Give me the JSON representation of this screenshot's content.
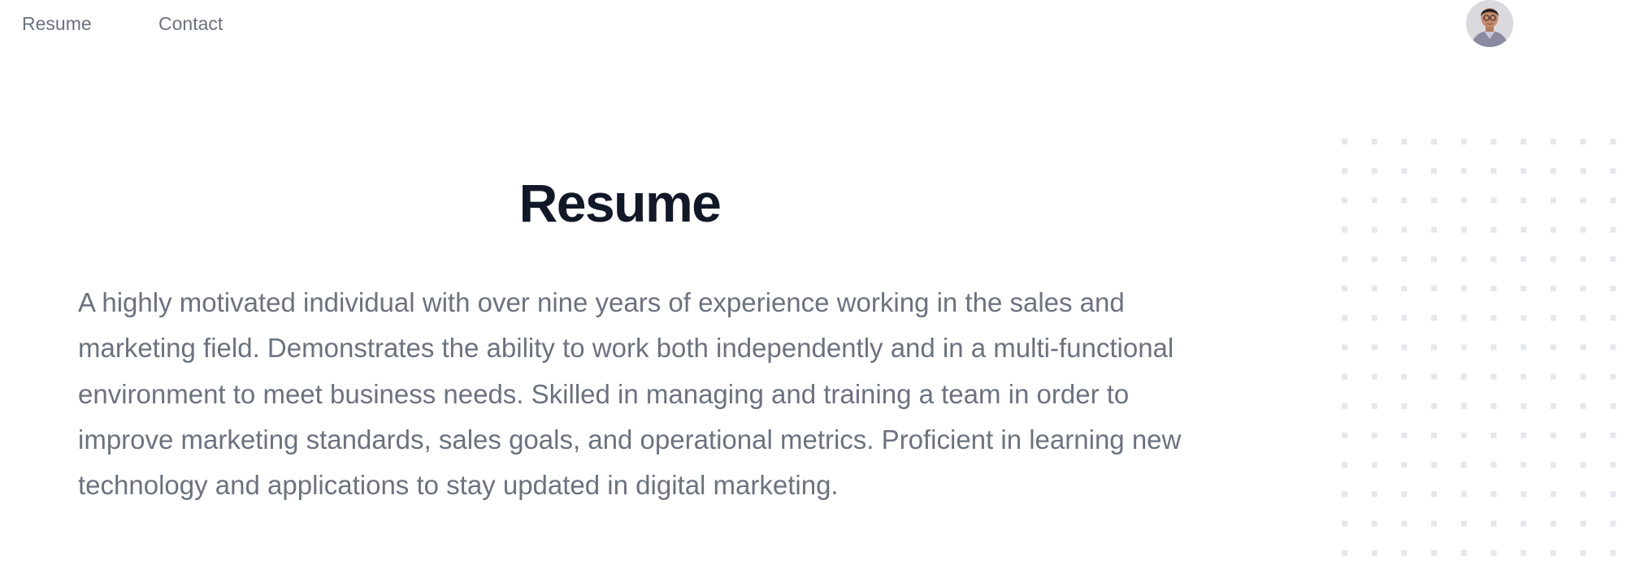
{
  "nav": {
    "items": [
      {
        "label": "Resume"
      },
      {
        "label": "Contact"
      }
    ]
  },
  "profile": {
    "avatar_icon": "user-photo-avatar"
  },
  "main": {
    "title": "Resume",
    "summary": "A highly motivated individual with over nine years of experience working in the sales and marketing field. Demonstrates the ability to work both independently and in a multi-functional environment to meet business needs. Skilled in managing and training a team in order to improve marketing standards, sales goals, and operational metrics. Proficient in learning new technology and applications to stay updated in digital marketing."
  },
  "colors": {
    "title": "#111827",
    "text_muted": "#6b7280",
    "dot_pattern": "#e5e7eb",
    "background": "#ffffff"
  }
}
